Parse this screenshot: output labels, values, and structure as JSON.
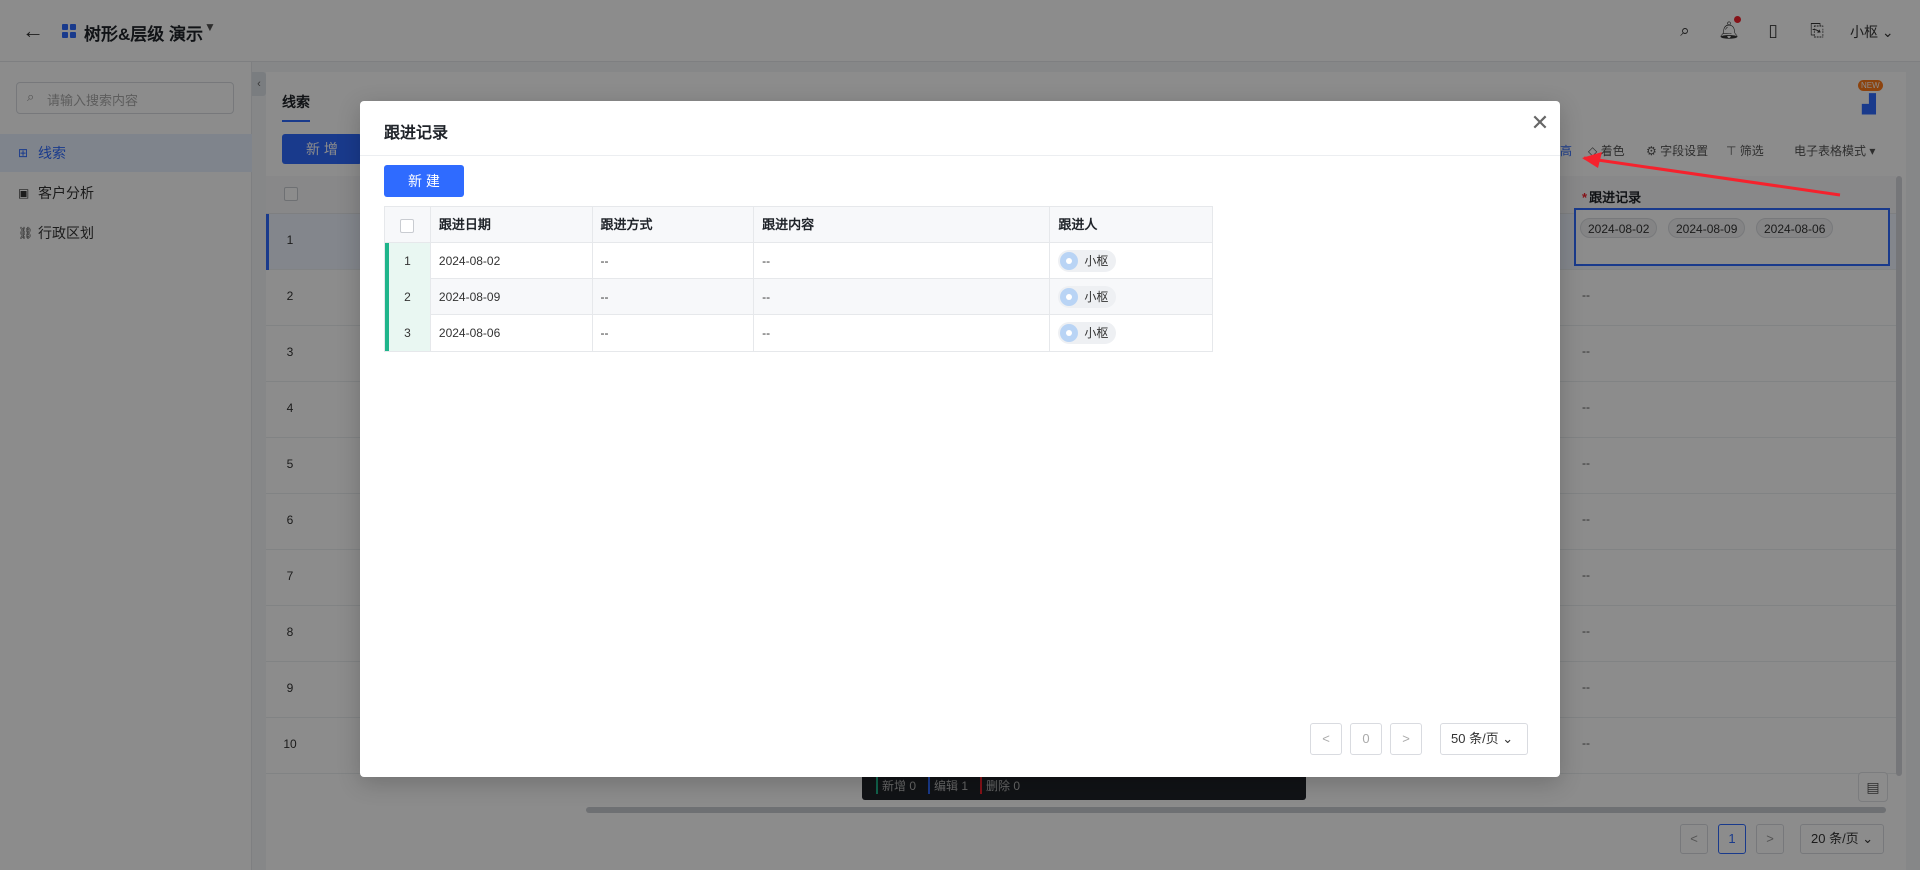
{
  "header": {
    "title": "树形&层级 演示",
    "user": "小枢"
  },
  "sidebar": {
    "search_placeholder": "请输入搜索内容",
    "items": [
      {
        "label": "线索",
        "active": true
      },
      {
        "label": "客户分析",
        "active": false
      },
      {
        "label": "行政区划",
        "active": false
      }
    ]
  },
  "main": {
    "tab": "线索",
    "new_button": "新 增",
    "toolbar": [
      "高",
      "着色",
      "字段设置",
      "筛选",
      "电子表格模式"
    ],
    "new_badge": "NEW",
    "column_follow": "跟进记录",
    "row_numbers": [
      "1",
      "2",
      "3",
      "4",
      "5",
      "6",
      "7",
      "8",
      "9",
      "10"
    ],
    "empty_cell": "--",
    "edit_tags": [
      "2024-08-02",
      "2024-08-09",
      "2024-08-06"
    ],
    "bottom_bar": [
      "新增 0",
      "编辑 1",
      "删除 0"
    ],
    "pager": {
      "prev": "<",
      "page": "1",
      "next": ">",
      "size": "20 条/页"
    }
  },
  "modal": {
    "title": "跟进记录",
    "new_button": "新 建",
    "columns": [
      "跟进日期",
      "跟进方式",
      "跟进内容",
      "跟进人"
    ],
    "rows": [
      {
        "num": "1",
        "date": "2024-08-02",
        "method": "--",
        "content": "--",
        "person": "小枢"
      },
      {
        "num": "2",
        "date": "2024-08-09",
        "method": "--",
        "content": "--",
        "person": "小枢"
      },
      {
        "num": "3",
        "date": "2024-08-06",
        "method": "--",
        "content": "--",
        "person": "小枢"
      }
    ],
    "pager": {
      "prev": "<",
      "page": "0",
      "next": ">",
      "size": "50 条/页"
    }
  },
  "colors": {
    "accent": "#2f6bff",
    "success": "#1fb58b",
    "danger": "#f5222d"
  }
}
